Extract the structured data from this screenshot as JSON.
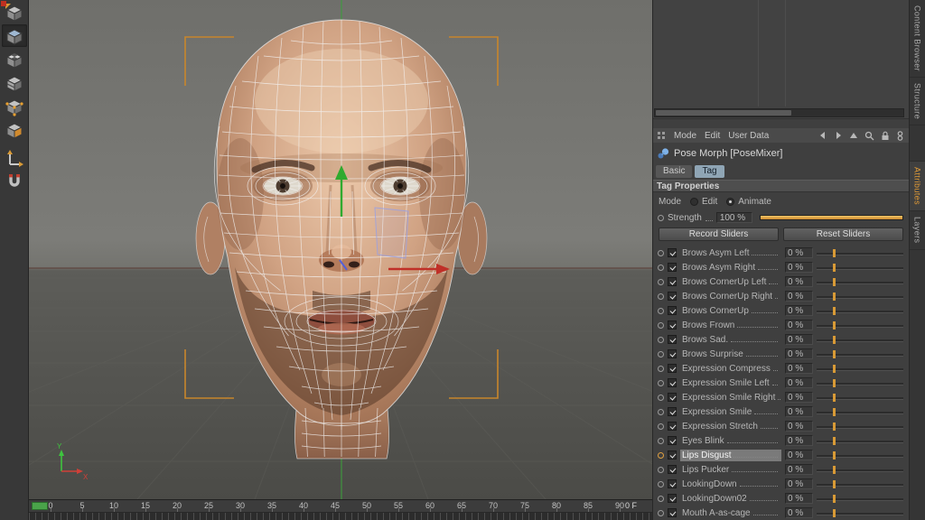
{
  "colors": {
    "accent_orange": "#d89a36",
    "tag_tab_blue": "#8fa5b5",
    "timeline_green": "#4aa34a"
  },
  "left_toolbar": {
    "tools": [
      "make-editable",
      "model-mode",
      "texture-mode",
      "workplane-mode",
      "points-mode",
      "polygons-mode",
      "enable-axis",
      "snapping"
    ]
  },
  "viewport": {
    "axis_labels": {
      "x": "X",
      "y": "Y"
    },
    "timeline": {
      "ticks": [
        "0",
        "5",
        "10",
        "15",
        "20",
        "25",
        "30",
        "35",
        "40",
        "45",
        "50",
        "55",
        "60",
        "65",
        "70",
        "75",
        "80",
        "85",
        "90"
      ],
      "current_frame": "0 F"
    }
  },
  "right_panel": {
    "side_tabs": [
      {
        "label": "Content Browser",
        "active": false
      },
      {
        "label": "Structure",
        "active": false
      },
      {
        "label": "Attributes",
        "active": true
      },
      {
        "label": "Layers",
        "active": false
      }
    ],
    "menu": {
      "items": [
        "Mode",
        "Edit",
        "User Data"
      ]
    },
    "object_title": "Pose Morph [PoseMixer]",
    "tabs": [
      {
        "label": "Basic",
        "active": false
      },
      {
        "label": "Tag",
        "active": true
      }
    ],
    "section": "Tag Properties",
    "mode": {
      "label": "Mode",
      "options": [
        {
          "label": "Edit",
          "selected": false
        },
        {
          "label": "Animate",
          "selected": true
        }
      ]
    },
    "strength": {
      "label": "Strength",
      "value": "100 %"
    },
    "actions": {
      "record": "Record Sliders",
      "reset": "Reset Sliders"
    },
    "sliders": [
      {
        "name": "Brows Asym Left",
        "value": "0 %"
      },
      {
        "name": "Brows Asym Right",
        "value": "0 %"
      },
      {
        "name": "Brows CornerUp Left",
        "value": "0 %"
      },
      {
        "name": "Brows CornerUp Right",
        "value": "0 %"
      },
      {
        "name": "Brows CornerUp",
        "value": "0 %"
      },
      {
        "name": "Brows Frown",
        "value": "0 %"
      },
      {
        "name": "Brows Sad.",
        "value": "0 %"
      },
      {
        "name": "Brows Surprise",
        "value": "0 %"
      },
      {
        "name": "Expression Compress",
        "value": "0 %"
      },
      {
        "name": "Expression Smile Left",
        "value": "0 %"
      },
      {
        "name": "Expression Smile Right",
        "value": "0 %"
      },
      {
        "name": "Expression Smile",
        "value": "0 %"
      },
      {
        "name": "Expression Stretch",
        "value": "0 %"
      },
      {
        "name": "Eyes Blink",
        "value": "0 %"
      },
      {
        "name": "Lips Disgust",
        "value": "0 %",
        "selected": true
      },
      {
        "name": "Lips Pucker",
        "value": "0 %"
      },
      {
        "name": "LookingDown",
        "value": "0 %"
      },
      {
        "name": "LookingDown02",
        "value": "0 %"
      },
      {
        "name": "Mouth A-as-cage",
        "value": "0 %"
      }
    ]
  }
}
